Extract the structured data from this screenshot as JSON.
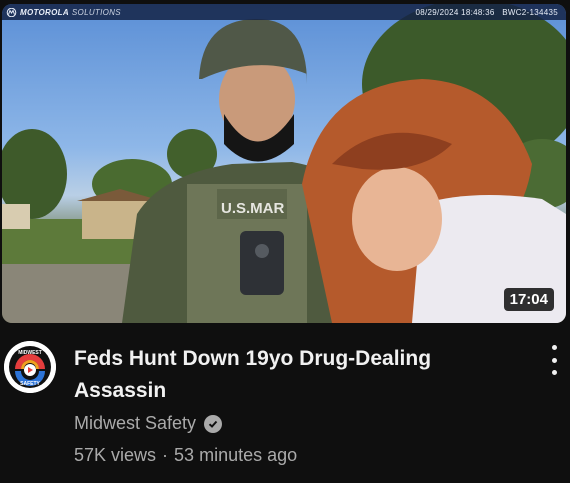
{
  "thumbnail": {
    "overlay_brand": "MOTOROLA",
    "overlay_brand_sub": "SOLUTIONS",
    "overlay_timestamp": "08/29/2024 18:48:36",
    "overlay_device_id": "BWC2-134435",
    "vest_text": "U.S.MAR",
    "duration": "17:04"
  },
  "video": {
    "title": "Feds Hunt Down 19yo Drug-Dealing Assassin",
    "channel_name": "Midwest Safety",
    "views": "57K views",
    "separator": "·",
    "uploaded": "53 minutes ago"
  },
  "avatar": {
    "text_top": "MIDWEST",
    "text_bottom": "SAFETY"
  },
  "icons": {
    "verified": "check-circle-icon",
    "more": "more-vertical-icon",
    "brand": "motorola-logo-icon"
  },
  "colors": {
    "background": "#0f0f0f",
    "primary_text": "#f1f1f1",
    "secondary_text": "#aaaaaa"
  }
}
